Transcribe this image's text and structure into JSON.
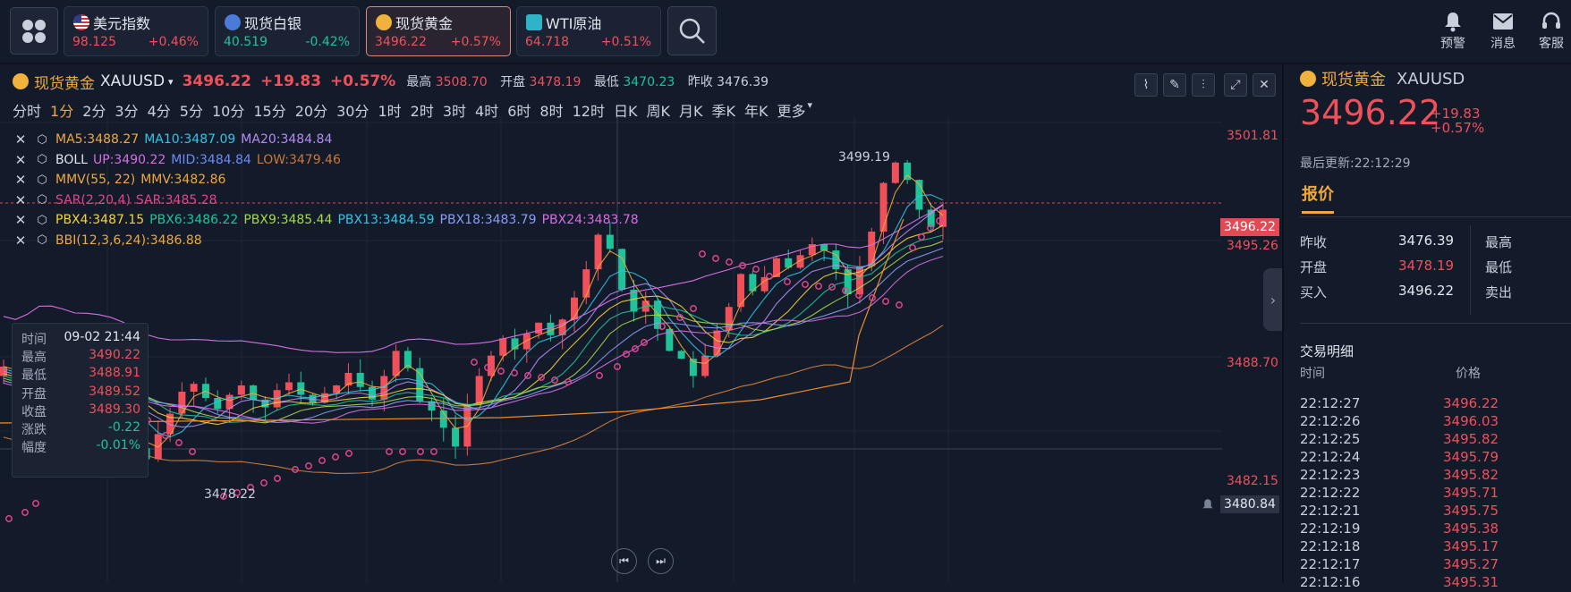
{
  "topbar": {
    "tiles": [
      {
        "name": "美元指数",
        "value": "98.125",
        "pct": "+0.46%"
      },
      {
        "name": "现货白银",
        "value": "40.519",
        "pct": "-0.42%"
      },
      {
        "name": "现货黄金",
        "value": "3496.22",
        "pct": "+0.57%"
      },
      {
        "name": "WTI原油",
        "value": "64.718",
        "pct": "+0.51%"
      }
    ],
    "actions": {
      "alert": "预警",
      "message": "消息",
      "service": "客服"
    }
  },
  "chart_header": {
    "name": "现货黄金",
    "symbol": "XAUUSD",
    "price": "3496.22",
    "change": "+19.83",
    "pct": "+0.57%",
    "high_label": "最高",
    "high": "3508.70",
    "open_label": "开盘",
    "open": "3478.19",
    "low_label": "最低",
    "low": "3470.23",
    "prev_label": "昨收",
    "prev": "3476.39"
  },
  "periods": [
    "分时",
    "1分",
    "2分",
    "3分",
    "4分",
    "5分",
    "10分",
    "15分",
    "20分",
    "30分",
    "1时",
    "2时",
    "3时",
    "4时",
    "6时",
    "8时",
    "12时",
    "日K",
    "周K",
    "月K",
    "季K",
    "年K",
    "更多"
  ],
  "selected_period": "1分",
  "indicators": [
    {
      "parts": [
        {
          "t": "MA5:3488.27",
          "c": "#f0a83c"
        },
        {
          "t": "MA10:3487.09",
          "c": "#2ec7e6"
        },
        {
          "t": "MA20:3484.84",
          "c": "#b48cf2"
        }
      ]
    },
    {
      "parts": [
        {
          "t": "BOLL",
          "c": "#e2e6ee"
        },
        {
          "t": "UP:3490.22",
          "c": "#d66ee0"
        },
        {
          "t": "MID:3484.84",
          "c": "#6c8cf5"
        },
        {
          "t": "LOW:3479.46",
          "c": "#c8783a"
        }
      ]
    },
    {
      "parts": [
        {
          "t": "MMV(55, 22)",
          "c": "#f0a83c"
        },
        {
          "t": "MMV:3482.86",
          "c": "#f0a83c"
        }
      ]
    },
    {
      "parts": [
        {
          "t": "SAR(2,20,4)",
          "c": "#e2458c"
        },
        {
          "t": "SAR:3485.28",
          "c": "#e2458c"
        }
      ]
    },
    {
      "parts": [
        {
          "t": "PBX4:3487.15",
          "c": "#f2d33c"
        },
        {
          "t": "PBX6:3486.22",
          "c": "#1fc39a"
        },
        {
          "t": "PBX9:3485.44",
          "c": "#a8d84a"
        },
        {
          "t": "PBX13:3484.59",
          "c": "#2ec7e6"
        },
        {
          "t": "PBX18:3483.79",
          "c": "#8c9cf5"
        },
        {
          "t": "PBX24:3483.78",
          "c": "#d66ee0"
        }
      ]
    },
    {
      "parts": [
        {
          "t": "BBI(12,3,6,24):3486.88",
          "c": "#f0a83c"
        }
      ]
    }
  ],
  "tooltip": {
    "rows": [
      {
        "k": "时间",
        "v": "09-02 21:44",
        "c": "#e2e6ee"
      },
      {
        "k": "最高",
        "v": "3490.22",
        "c": "#f0505a"
      },
      {
        "k": "最低",
        "v": "3488.91",
        "c": "#f0505a"
      },
      {
        "k": "开盘",
        "v": "3489.52",
        "c": "#f0505a"
      },
      {
        "k": "收盘",
        "v": "3489.30",
        "c": "#f0505a"
      },
      {
        "k": "涨跌",
        "v": "-0.22",
        "c": "#1fc39a"
      },
      {
        "k": "幅度",
        "v": "-0.01%",
        "c": "#1fc39a"
      }
    ]
  },
  "price_axis": {
    "ticks": [
      "3501.81",
      "3495.26",
      "3488.70",
      "3482.15"
    ],
    "current": "3496.22",
    "crosshair": "3480.84"
  },
  "annotations": {
    "max": "3499.19",
    "min": "3478.22"
  },
  "sidebar": {
    "name": "现货黄金",
    "symbol": "XAUUSD",
    "price": "3496.22",
    "change": "+19.83",
    "pct": "+0.57%",
    "updated": "最后更新:22:12:29",
    "tab": "报价",
    "quotes": [
      {
        "k": "昨收",
        "v": "3476.39",
        "c": "#e2e6ee",
        "k2": "最高"
      },
      {
        "k": "开盘",
        "v": "3478.19",
        "c": "#f0505a",
        "k2": "最低"
      },
      {
        "k": "买入",
        "v": "3496.22",
        "c": "#e2e6ee",
        "k2": "卖出"
      }
    ],
    "trades_title": "交易明细",
    "trades_header": {
      "time": "时间",
      "price": "价格"
    },
    "trades": [
      {
        "t": "22:12:27",
        "p": "3496.22"
      },
      {
        "t": "22:12:26",
        "p": "3496.03"
      },
      {
        "t": "22:12:25",
        "p": "3495.82"
      },
      {
        "t": "22:12:24",
        "p": "3495.79"
      },
      {
        "t": "22:12:23",
        "p": "3495.82"
      },
      {
        "t": "22:12:22",
        "p": "3495.71"
      },
      {
        "t": "22:12:21",
        "p": "3495.75"
      },
      {
        "t": "22:12:19",
        "p": "3495.38"
      },
      {
        "t": "22:12:18",
        "p": "3495.17"
      },
      {
        "t": "22:12:17",
        "p": "3495.27"
      },
      {
        "t": "22:12:16",
        "p": "3495.31"
      }
    ]
  },
  "chart_data": {
    "type": "candlestick",
    "series": [
      {
        "name": "XAUUSD"
      }
    ]
  },
  "colors": {
    "up": "#f0505a",
    "down": "#1fc39a",
    "accent": "#f0a83c",
    "bg": "#131a2a"
  }
}
